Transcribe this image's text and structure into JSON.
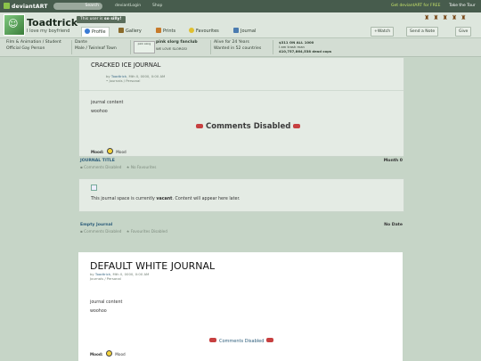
{
  "topbar": {
    "logo": "deviantART",
    "search": "Search",
    "links": [
      "deviantLogin",
      "Shop"
    ],
    "deal": "Get deviantART for FREE",
    "tour": "Take the Tour"
  },
  "profile": {
    "username": "Toadtrick",
    "tagline": "I love my boyfriend",
    "status_pre": "This user is",
    "status_bold": "so silly!"
  },
  "tabs": [
    "Profile",
    "Gallery",
    "Prints",
    "Favourites",
    "Journal"
  ],
  "buttons": {
    "watch": "+Watch",
    "note": "Send a Note",
    "give": "Give"
  },
  "info": {
    "role1": "Film & Animation / Student",
    "role2": "Official Gay Person",
    "name": "Dante",
    "gender": "Male / Twinleaf Town",
    "group_title": "pink slorg fanclub",
    "group_sub": "WE LOVE SLORGS!",
    "group_badge": "pink slorg",
    "alive": "Alive for 24 Years",
    "wanted": "Wanted in 52 countries",
    "stat1": "$311 ON ALL 1000",
    "stat2": "I am trash man",
    "stat3": "410,757,864,538 dead cops"
  },
  "journal1": {
    "title": "CRACKED ICE JOURNAL",
    "by": "by",
    "author": "Toadtrick",
    "date": "Mth 0, 0000, 0:00 AM",
    "cat": "Journals / Personal",
    "body1": "journal content",
    "body2": "woohoo",
    "comments": "Comments Disabled",
    "mood_label": "Mood:",
    "mood": "Mood"
  },
  "footer1": {
    "title": "JOURNAL TITLE",
    "month": "Month 0",
    "cd": "Comments Disabled",
    "fav": "No Favourites"
  },
  "empty": {
    "text_pre": "This journal space is currently",
    "text_bold": "vacant",
    "text_post": ". Content will appear here later."
  },
  "footer2": {
    "title": "Empty Journal",
    "date": "No Date",
    "cd": "Comments Disabled",
    "fav": "Favourites Disabled"
  },
  "journal2": {
    "title": "DEFAULT WHITE JOURNAL",
    "by": "by",
    "author": "Toadtrick",
    "date": "Mth 0, 0000, 0:00 AM",
    "cat": "Journals / Personal",
    "body1": "journal content",
    "body2": "woohoo",
    "comments": "Comments Disabled",
    "mood_label": "Mood:",
    "mood": "Mood"
  }
}
